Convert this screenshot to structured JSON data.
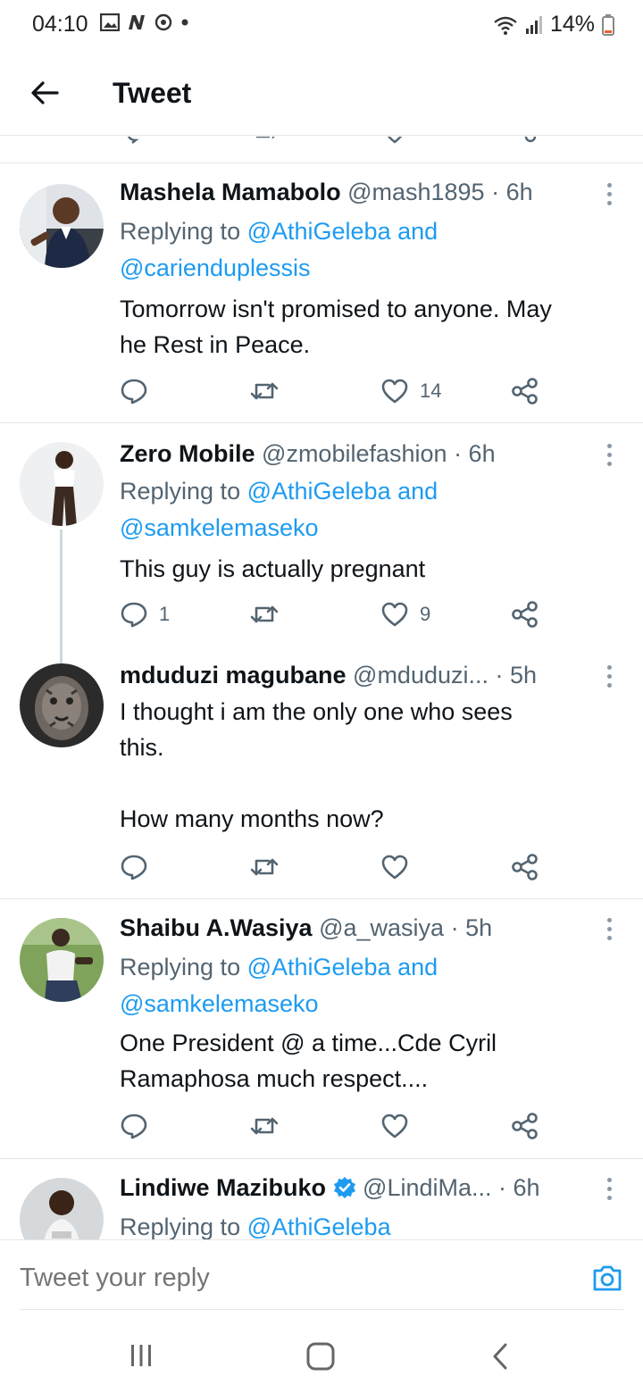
{
  "status_bar": {
    "time": "04:10",
    "battery": "14%"
  },
  "header": {
    "title": "Tweet"
  },
  "tweets": [
    {
      "name": "Mashela Mamabolo",
      "handle": "@mash1895",
      "time": "· 6h",
      "replying_prefix": "Replying to ",
      "replying_line1": "@AthiGeleba and",
      "replying_line2": "@carienduplessis",
      "body": "Tomorrow isn't promised to anyone. May\nhe Rest in Peace.",
      "reply_count": "",
      "like_count": "14"
    },
    {
      "name": "Zero Mobile",
      "handle": "@zmobilefashion",
      "time": "· 6h",
      "replying_prefix": "Replying to ",
      "replying_line1": "@AthiGeleba and",
      "replying_line2": "@samkelemaseko",
      "body": "This guy is actually pregnant",
      "reply_count": "1",
      "like_count": "9"
    },
    {
      "name": "mduduzi magubane",
      "handle": "@mduduzi...",
      "time": "· 5h",
      "body": "I thought i am the only one who sees\nthis.\n\nHow many months now?",
      "reply_count": "",
      "like_count": ""
    },
    {
      "name": "Shaibu A.Wasiya",
      "handle": "@a_wasiya",
      "time": "· 5h",
      "replying_prefix": "Replying to ",
      "replying_line1": "@AthiGeleba and",
      "replying_line2": "@samkelemaseko",
      "body": "One President @ a time...Cde Cyril\nRamaphosa much respect....",
      "reply_count": "",
      "like_count": ""
    },
    {
      "name": "Lindiwe Mazibuko",
      "handle": "@LindiMa...",
      "time": "· 6h",
      "verified": true,
      "replying_prefix": "Replying to ",
      "replying_line1": "@AthiGeleba"
    }
  ],
  "reply_bar": {
    "placeholder": "Tweet your reply"
  },
  "colors": {
    "link": "#1d9bf0",
    "secondary": "#536471",
    "primary": "#0f1419",
    "divider": "#e6e6e6"
  },
  "icons": [
    "back-arrow-icon",
    "reply-icon",
    "retweet-icon",
    "like-icon",
    "share-icon",
    "more-icon",
    "camera-icon",
    "verified-badge-icon"
  ]
}
